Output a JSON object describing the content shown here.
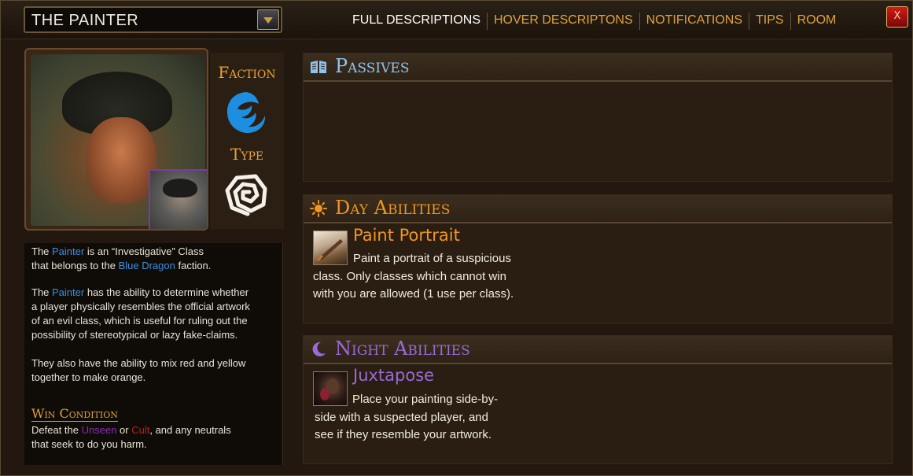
{
  "header": {
    "class_name": "THE PAINTER",
    "tabs": [
      "FULL DESCRIPTIONS",
      "HOVER DESCRIPTONS",
      "NOTIFICATIONS",
      "TIPS",
      "ROOM"
    ],
    "close_label": "X"
  },
  "side": {
    "faction_label": "Faction",
    "type_label": "Type",
    "faction_icon": "blue-dragon-icon",
    "type_icon": "investigative-spiral-icon"
  },
  "description": {
    "p1_a": "The ",
    "p1_painter": "Painter",
    "p1_b": " is an “Investigative” Class",
    "p1_c": "that belongs to the ",
    "p1_faction": "Blue Dragon",
    "p1_d": " faction.",
    "p2_a": "The ",
    "p2_painter": "Painter",
    "p2_b": " has the ability to determine whether",
    "p2_c": "a player physically resembles the official artwork",
    "p2_d": "of an evil class, which is useful for ruling out the",
    "p2_e": "possibility of stereotypical or lazy fake-claims.",
    "p3_a": "They also have the ability to mix red and yellow",
    "p3_b": "together to make orange.",
    "win_title": "Win Condition",
    "win_a": "Defeat the ",
    "win_unseen": "Unseen",
    "win_or": " or ",
    "win_cult": "Cult",
    "win_b": ", and any neutrals",
    "win_c": "that seek to do you harm."
  },
  "passives": {
    "title": "Passives",
    "icon": "book-icon"
  },
  "day": {
    "title": "Day Abilities",
    "icon": "sun-icon",
    "ability_name": "Paint Portrait",
    "line1": "Paint a portrait of a suspicious",
    "line2": "class.  Only classes which cannot win",
    "line3": "with you are allowed (1 use per class)."
  },
  "night": {
    "title": "Night Abilities",
    "icon": "moon-icon",
    "ability_name": "Juxtapose",
    "line1": "Place your painting side-by-",
    "line2": "side with a suspected player, and",
    "line3": "see if they resemble your artwork."
  },
  "colors": {
    "gold": "#e8a232",
    "passive_blue": "#8fc4f0",
    "day_orange": "#f0961e",
    "night_purple": "#9a6ad8"
  }
}
